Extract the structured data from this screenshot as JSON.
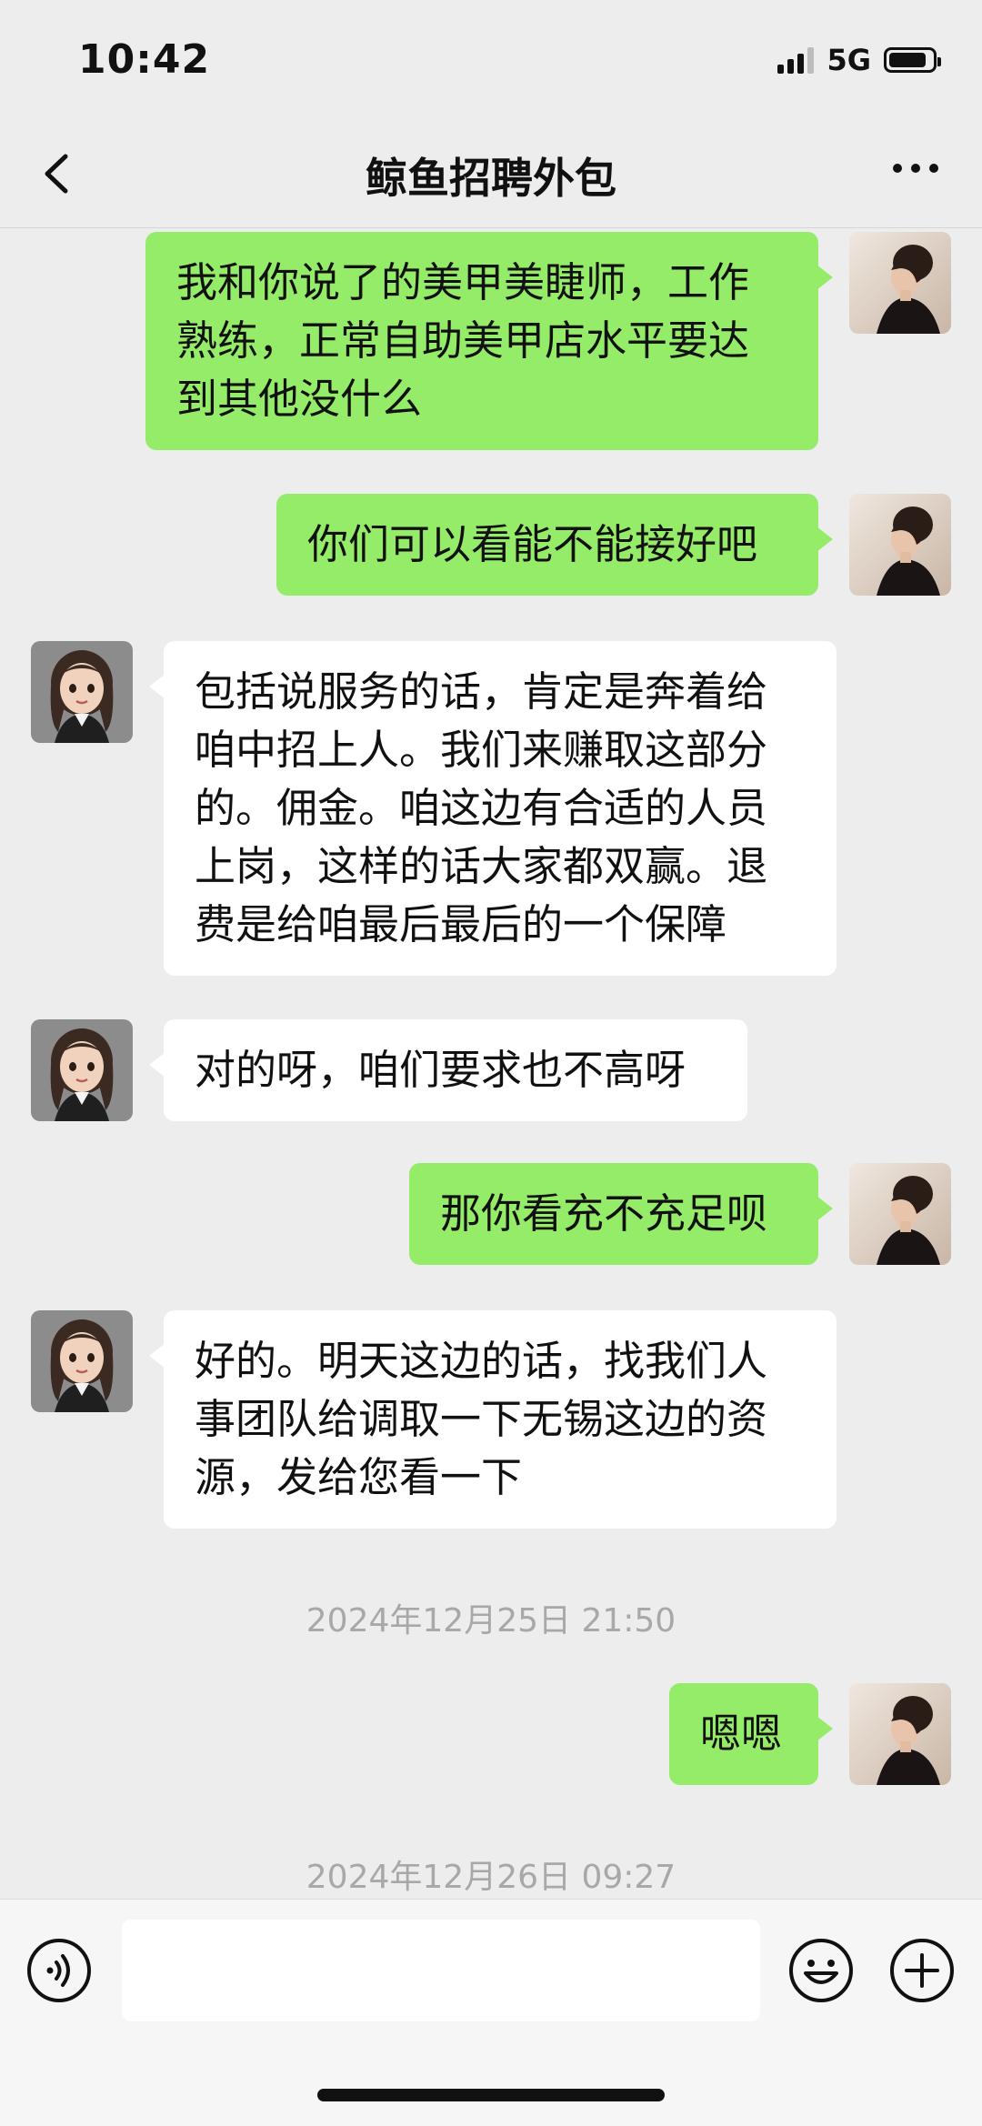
{
  "status_bar": {
    "time": "10:42",
    "network": "5G"
  },
  "header": {
    "back_icon": "chevron-left-icon",
    "title": "鲸鱼招聘外包",
    "more_icon": "more-dots-icon"
  },
  "messages": [
    {
      "side": "me",
      "text": "我和你说了的美甲美睫师，工作熟练，正常自助美甲店水平要达到其他没什么"
    },
    {
      "side": "me",
      "text": "你们可以看能不能接好吧"
    },
    {
      "side": "them",
      "text": "包括说服务的话，肯定是奔着给咱中招上人。我们来赚取这部分的。佣金。咱这边有合适的人员上岗，这样的话大家都双赢。退费是给咱最后最后的一个保障"
    },
    {
      "side": "them",
      "text": "对的呀，咱们要求也不高呀"
    },
    {
      "side": "me",
      "text": "那你看充不充足呗"
    },
    {
      "side": "them",
      "text": "好的。明天这边的话，找我们人事团队给调取一下无锡这边的资源，发给您看一下"
    }
  ],
  "timestamp_1": "2024年12月25日 21:50",
  "message_7": {
    "side": "me",
    "text": "嗯嗯"
  },
  "timestamp_2": "2024年12月26日 09:27",
  "input_bar": {
    "voice_icon": "voice-icon",
    "input_value": "",
    "emoji_icon": "emoji-icon",
    "plus_icon": "plus-icon"
  },
  "colors": {
    "my_bubble": "#95ec69",
    "their_bubble": "#ffffff",
    "background": "#ededed"
  }
}
